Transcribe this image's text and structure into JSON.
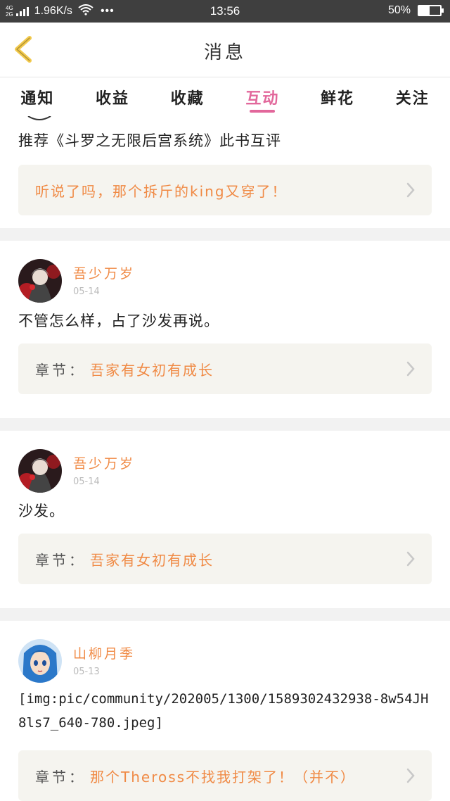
{
  "status_bar": {
    "network_top": "4G",
    "network_bottom": "2G",
    "speed": "1.96K/s",
    "time": "13:56",
    "battery": "50%",
    "battery_level": 0.5
  },
  "header": {
    "title": "消息"
  },
  "tabs": [
    {
      "label": "通知"
    },
    {
      "label": "收益"
    },
    {
      "label": "收藏"
    },
    {
      "label": "互动",
      "active": true
    },
    {
      "label": "鲜花"
    },
    {
      "label": "关注"
    }
  ],
  "colors": {
    "accent_pink": "#e2679b",
    "accent_orange": "#f08a45",
    "ref_bg": "#f5f4ef"
  },
  "feed": {
    "top_card": {
      "comment": "推荐《斗罗之无限后宫系统》此书互评",
      "ref_text": "听说了吗，那个拆斤的king又穿了！"
    },
    "items": [
      {
        "username": "吾少万岁",
        "date": "05-14",
        "comment": "不管怎么样，占了沙发再说。",
        "ref_label": "章节：",
        "ref_text": "吾家有女初有成长"
      },
      {
        "username": "吾少万岁",
        "date": "05-14",
        "comment": "沙发。",
        "ref_label": "章节：",
        "ref_text": "吾家有女初有成长"
      },
      {
        "username": "山柳月季",
        "date": "05-13",
        "comment": "[img:pic/community/202005/1300/1589302432938-8w54JH8ls7_640-780.jpeg]",
        "ref_label": "章节：",
        "ref_text": "那个Theross不找我打架了！（并不）"
      }
    ]
  }
}
